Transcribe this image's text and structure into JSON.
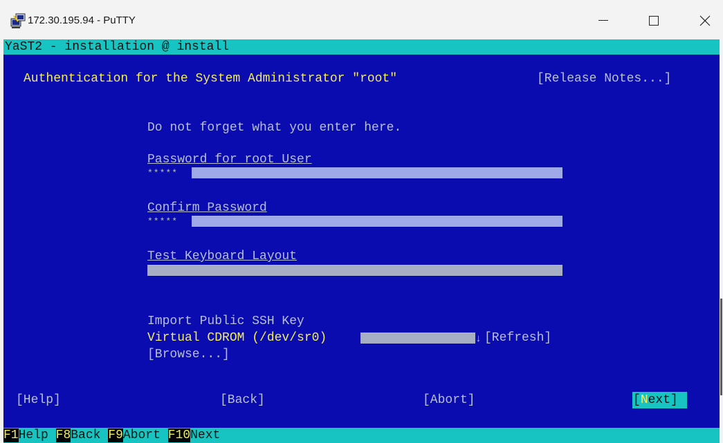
{
  "window": {
    "title": "172.30.195.94 - PuTTY",
    "minimize_glyph": "—",
    "maximize_glyph": "☐",
    "close_glyph": "✕"
  },
  "terminal": {
    "header_title": "YaST2 - installation @ install",
    "dialog_title": "Authentication for the System Administrator \"root\"",
    "release_notes": "[Release Notes...]",
    "hint": "Do not forget what you enter here.",
    "password_label": "Password for root User",
    "password_value": "*****",
    "confirm_label": "Confirm Password",
    "confirm_value": "*****",
    "keyboard_label": "Test Keyboard Layout",
    "ssh_label": "Import Public SSH Key",
    "ssh_device": "Virtual CDROM (/dev/sr0)",
    "ssh_arrow": "↓",
    "refresh": "[Refresh]",
    "browse": "[Browse...]",
    "help_btn": "[Help]",
    "back_btn": "[Back]",
    "abort_btn": "[Abort]",
    "next_btn_open": "[",
    "next_btn_hot": "N",
    "next_btn_rest": "ext]"
  },
  "fkeys": [
    {
      "key": "F1",
      "label": "Help"
    },
    {
      "key": "F8",
      "label": "Back"
    },
    {
      "key": "F9",
      "label": "Abort"
    },
    {
      "key": "F10",
      "label": "Next"
    }
  ],
  "colors": {
    "terminal_bg": "#0b0cb0",
    "cyan": "#17c4c2",
    "yellow": "#f2ec5e",
    "text": "#b7c0d2"
  }
}
